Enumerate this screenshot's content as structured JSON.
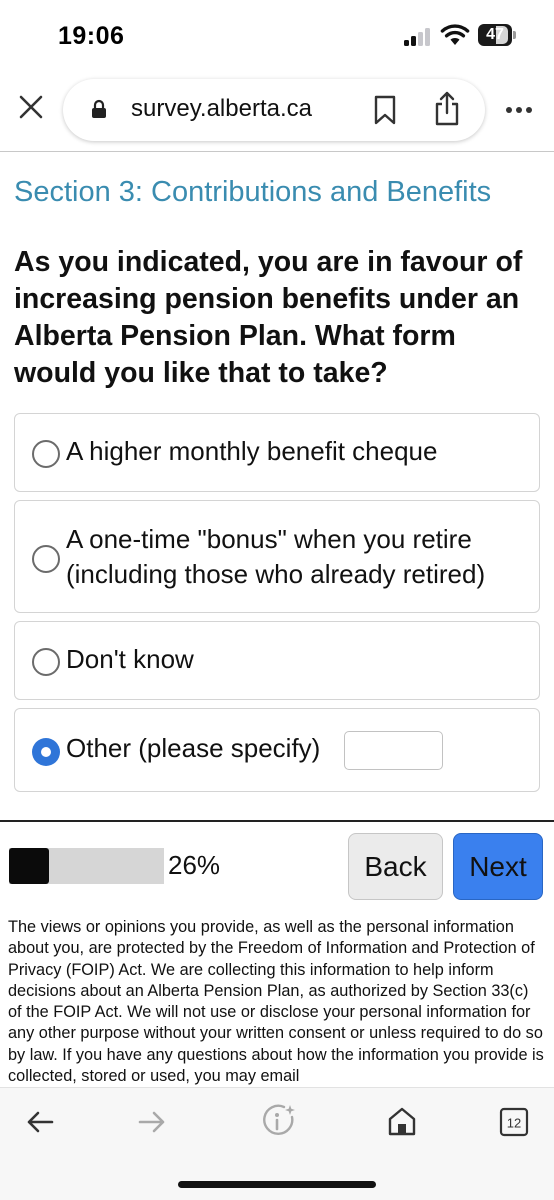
{
  "status_bar": {
    "time": "19:06",
    "battery": "47",
    "icons": [
      "signal-icon",
      "wifi-icon",
      "battery-icon"
    ]
  },
  "browser": {
    "url": "survey.alberta.ca",
    "icons": [
      "close-icon",
      "lock-icon",
      "bookmark-icon",
      "share-icon",
      "more-icon"
    ]
  },
  "survey": {
    "section_title": "Section 3: Contributions and Benefits",
    "question": "As you indicated, you are in favour of increasing pension benefits under an Alberta Pension Plan. What form would you like that to take?",
    "options": [
      {
        "label": "A higher monthly benefit cheque",
        "selected": false
      },
      {
        "label_line1": "A one-time \"bonus\" when you retire",
        "label_line2": "(including those who already retired)",
        "selected": false
      },
      {
        "label": "Don't know",
        "selected": false
      },
      {
        "label": "Other (please specify)",
        "selected": true,
        "specify_value": ""
      }
    ]
  },
  "navigation": {
    "progress_percent": 26,
    "progress_label": "26%",
    "back_label": "Back",
    "next_label": "Next"
  },
  "privacy_text": "The views or opinions you provide, as well as the personal information about you, are protected by the Freedom of Information and Protection of Privacy (FOIP) Act. We are collecting this information to help inform decisions about an Alberta Pension Plan, as authorized by Section 33(c) of the FOIP Act. We will not use or disclose your personal information for any other purpose without your written consent or unless required to do so by law. If you have any questions about how the information you provide is collected, stored or used, you may email",
  "toolbar": {
    "tab_count": "12",
    "icons": [
      "back-arrow-icon",
      "forward-arrow-icon",
      "info-sparkle-icon",
      "home-icon",
      "tabs-icon"
    ]
  },
  "colors": {
    "section_title": "#3a8cb0",
    "radio_selected": "#2f75d8",
    "next_button": "#3a80ee",
    "progress_fill": "#0b0b0b"
  }
}
